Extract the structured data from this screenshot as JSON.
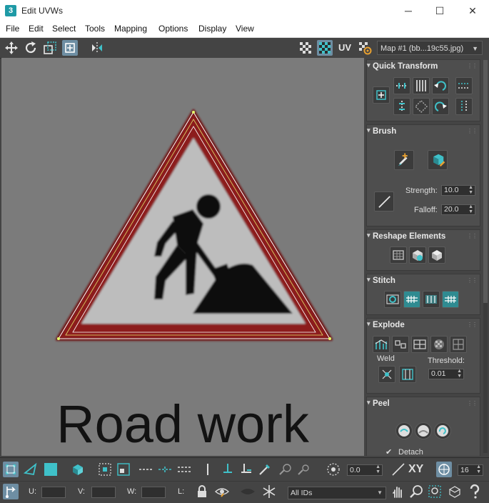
{
  "window": {
    "app_icon": "3",
    "title": "Edit UVWs",
    "minimize": "─",
    "maximize": "☐",
    "close": "✕"
  },
  "menu": [
    "File",
    "Edit",
    "Select",
    "Tools",
    "Mapping",
    "Options",
    "Display",
    "View"
  ],
  "toolbar": {
    "uv_label": "UV",
    "map_dropdown": "Map #1 (bb...19c55.jpg)"
  },
  "image_text": "Road work",
  "panels": {
    "quick_transform": {
      "title": "Quick Transform"
    },
    "brush": {
      "title": "Brush",
      "strength_label": "Strength:",
      "strength_value": "10.0",
      "falloff_label": "Falloff:",
      "falloff_value": "20.0"
    },
    "reshape": {
      "title": "Reshape Elements"
    },
    "stitch": {
      "title": "Stitch"
    },
    "explode": {
      "title": "Explode",
      "weld_label": "Weld",
      "threshold_label": "Threshold:",
      "threshold_value": "0.01"
    },
    "peel": {
      "title": "Peel",
      "detach_label": "Detach",
      "detach_checked": true
    }
  },
  "bottombar": {
    "angle_value": "0.0",
    "xy_label": "XY",
    "grid_value": "16",
    "u_label": "U:",
    "v_label": "V:",
    "w_label": "W:",
    "l_label": "L:",
    "ids_dropdown": "All IDs"
  },
  "colors": {
    "accent": "#3fc1c9",
    "selected": "#6e8ea3",
    "panel_bg": "#444444",
    "viewport_bg": "#7b7b7b"
  }
}
